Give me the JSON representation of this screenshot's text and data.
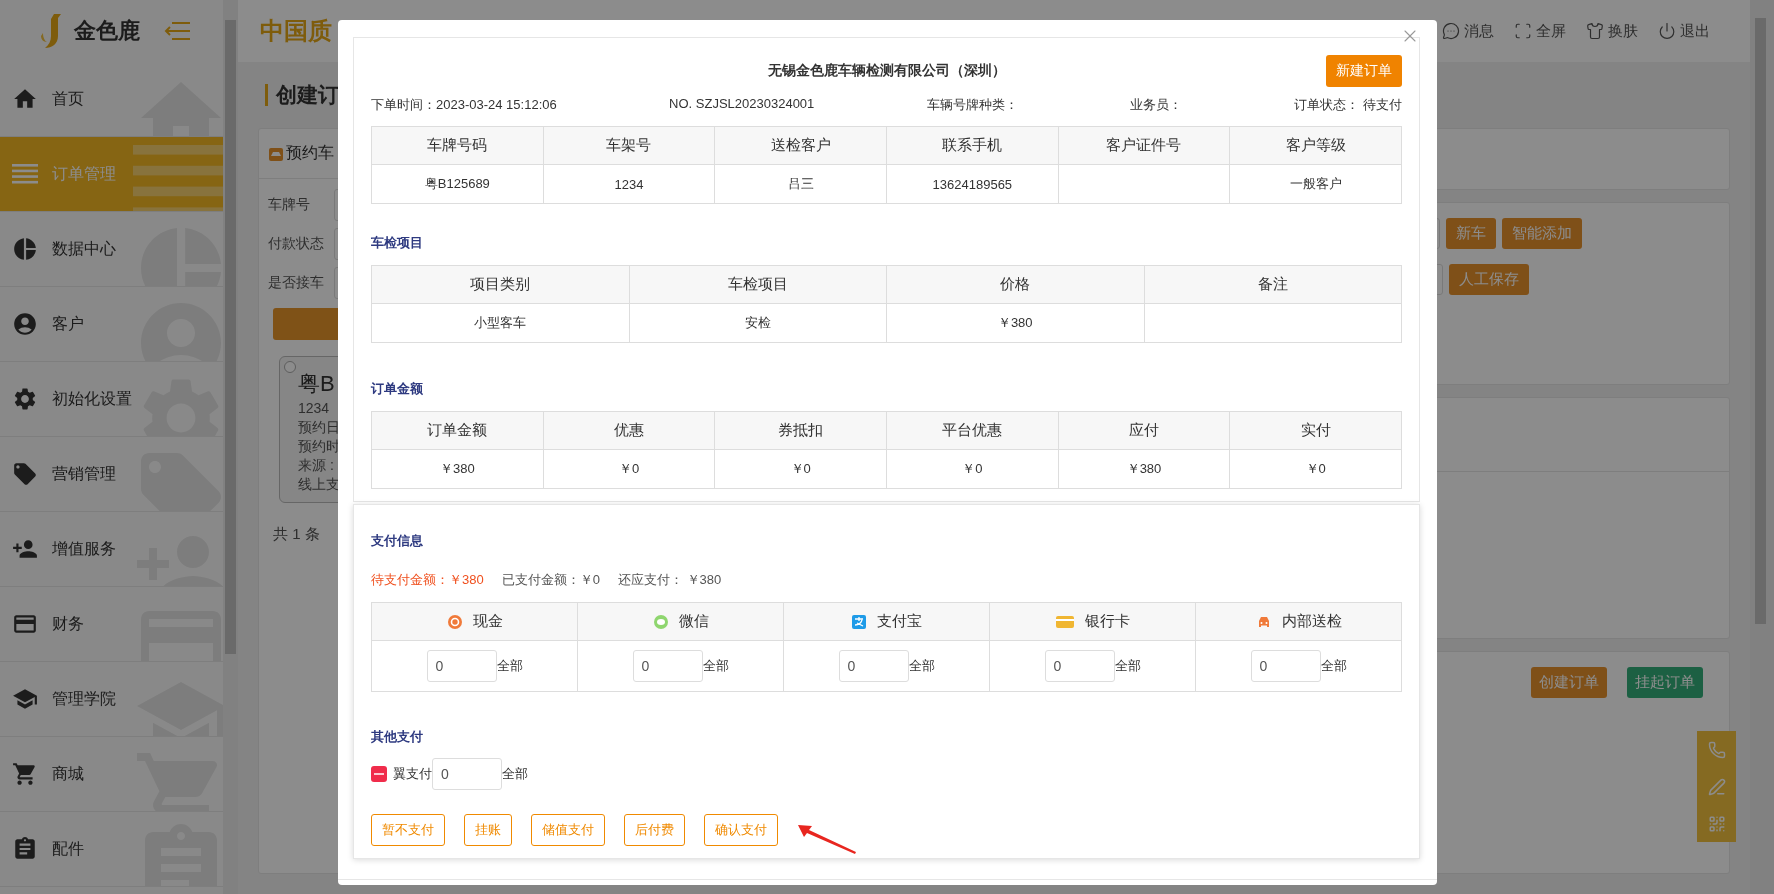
{
  "sidebar": {
    "logo": "金色鹿",
    "items": [
      {
        "label": "首页",
        "selected": false
      },
      {
        "label": "订单管理",
        "selected": true
      },
      {
        "label": "数据中心",
        "selected": false
      },
      {
        "label": "客户",
        "selected": false
      },
      {
        "label": "初始化设置",
        "selected": false
      },
      {
        "label": "营销管理",
        "selected": false
      },
      {
        "label": "增值服务",
        "selected": false
      },
      {
        "label": "财务",
        "selected": false
      },
      {
        "label": "管理学院",
        "selected": false
      },
      {
        "label": "商城",
        "selected": false
      },
      {
        "label": "配件",
        "selected": false
      }
    ]
  },
  "header": {
    "title": "中国质",
    "actions": [
      "消息",
      "全屏",
      "换肤",
      "退出"
    ]
  },
  "page": {
    "title": "创建订",
    "booking_panel": {
      "title": "预约车",
      "filters": [
        "车牌号",
        "付款状态",
        "是否接车"
      ],
      "card": {
        "selected": false,
        "plate": "粤B",
        "lines": [
          "1234",
          "预约日",
          "预约时",
          "来源 :",
          "线上支"
        ]
      },
      "total": "共 1 条"
    },
    "tool_rows": [
      [
        "新车",
        "智能添加"
      ],
      [
        "人工保存"
      ]
    ],
    "order_buttons": [
      {
        "label": "创建订单",
        "kind": "primary"
      },
      {
        "label": "挂起订单",
        "kind": "success"
      }
    ]
  },
  "modal": {
    "company": "无锡金色鹿车辆检测有限公司（深圳）",
    "new_order_button": "新建订单",
    "meta": [
      "下单时间：2023-03-24 15:12:06",
      "NO. SZJSL20230324001",
      "车辆号牌种类：",
      "业务员：",
      "订单状态： 待支付"
    ],
    "customer_table": {
      "columns": [
        "车牌号码",
        "车架号",
        "送检客户",
        "联系手机",
        "客户证件号",
        "客户等级"
      ],
      "rows": [
        [
          "粤B125689",
          "1234",
          "吕三",
          "13624189565",
          "",
          "一般客户"
        ]
      ]
    },
    "items_section": {
      "title": "车检项目",
      "columns": [
        "项目类别",
        "车检项目",
        "价格",
        "备注"
      ],
      "rows": [
        [
          "小型客车",
          "安检",
          "￥380",
          ""
        ]
      ]
    },
    "amount_section": {
      "title": "订单金额",
      "columns": [
        "订单金额",
        "优惠",
        "券抵扣",
        "平台优惠",
        "应付",
        "实付"
      ],
      "rows": [
        [
          "￥380",
          "￥0",
          "￥0",
          "￥0",
          "￥380",
          "￥0"
        ]
      ]
    },
    "payment": {
      "title": "支付信息",
      "summary": [
        {
          "text": "待支付金额：￥380",
          "kind": "due"
        },
        {
          "text": "已支付金额：￥0",
          "kind": "normal"
        },
        {
          "text": "还应支付： ￥380",
          "kind": "normal"
        }
      ],
      "methods": [
        {
          "label": "现金",
          "value": "0",
          "all": "全部"
        },
        {
          "label": "微信",
          "value": "0",
          "all": "全部"
        },
        {
          "label": "支付宝",
          "value": "0",
          "all": "全部"
        },
        {
          "label": "银行卡",
          "value": "0",
          "all": "全部"
        },
        {
          "label": "内部送检",
          "value": "0",
          "all": "全部"
        }
      ],
      "other_title": "其他支付",
      "other_methods": [
        {
          "label": "翼支付",
          "value": "0",
          "all": "全部"
        }
      ],
      "actions": [
        "暂不支付",
        "挂账",
        "储值支付",
        "后付费",
        "确认支付"
      ]
    }
  }
}
